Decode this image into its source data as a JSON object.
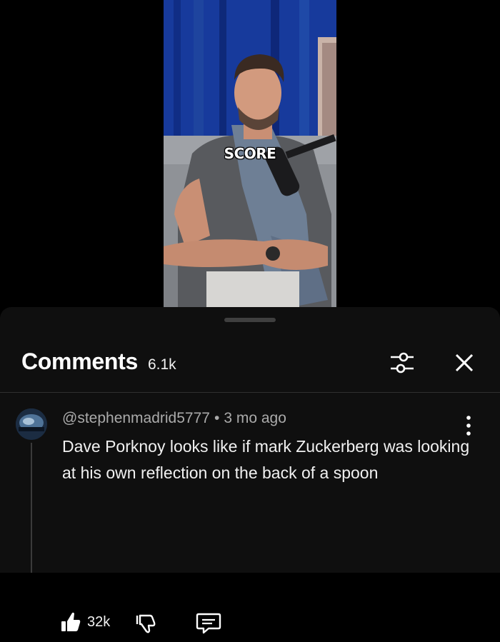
{
  "video": {
    "caption": "SCORE"
  },
  "comments_panel": {
    "title": "Comments",
    "count": "6.1k",
    "icons": {
      "filter": "sliders-icon",
      "close": "close-icon"
    }
  },
  "comment": {
    "author": "@stephenmadrid5777",
    "separator": "•",
    "time": "3 mo ago",
    "text": "Dave Porknoy looks like if mark Zuckerberg was looking at his own reflection on the back of a spoon",
    "likes": "32k",
    "icons": {
      "like": "thumbs-up-icon",
      "dislike": "thumbs-down-icon",
      "reply": "reply-icon",
      "more": "more-vertical-icon"
    }
  }
}
